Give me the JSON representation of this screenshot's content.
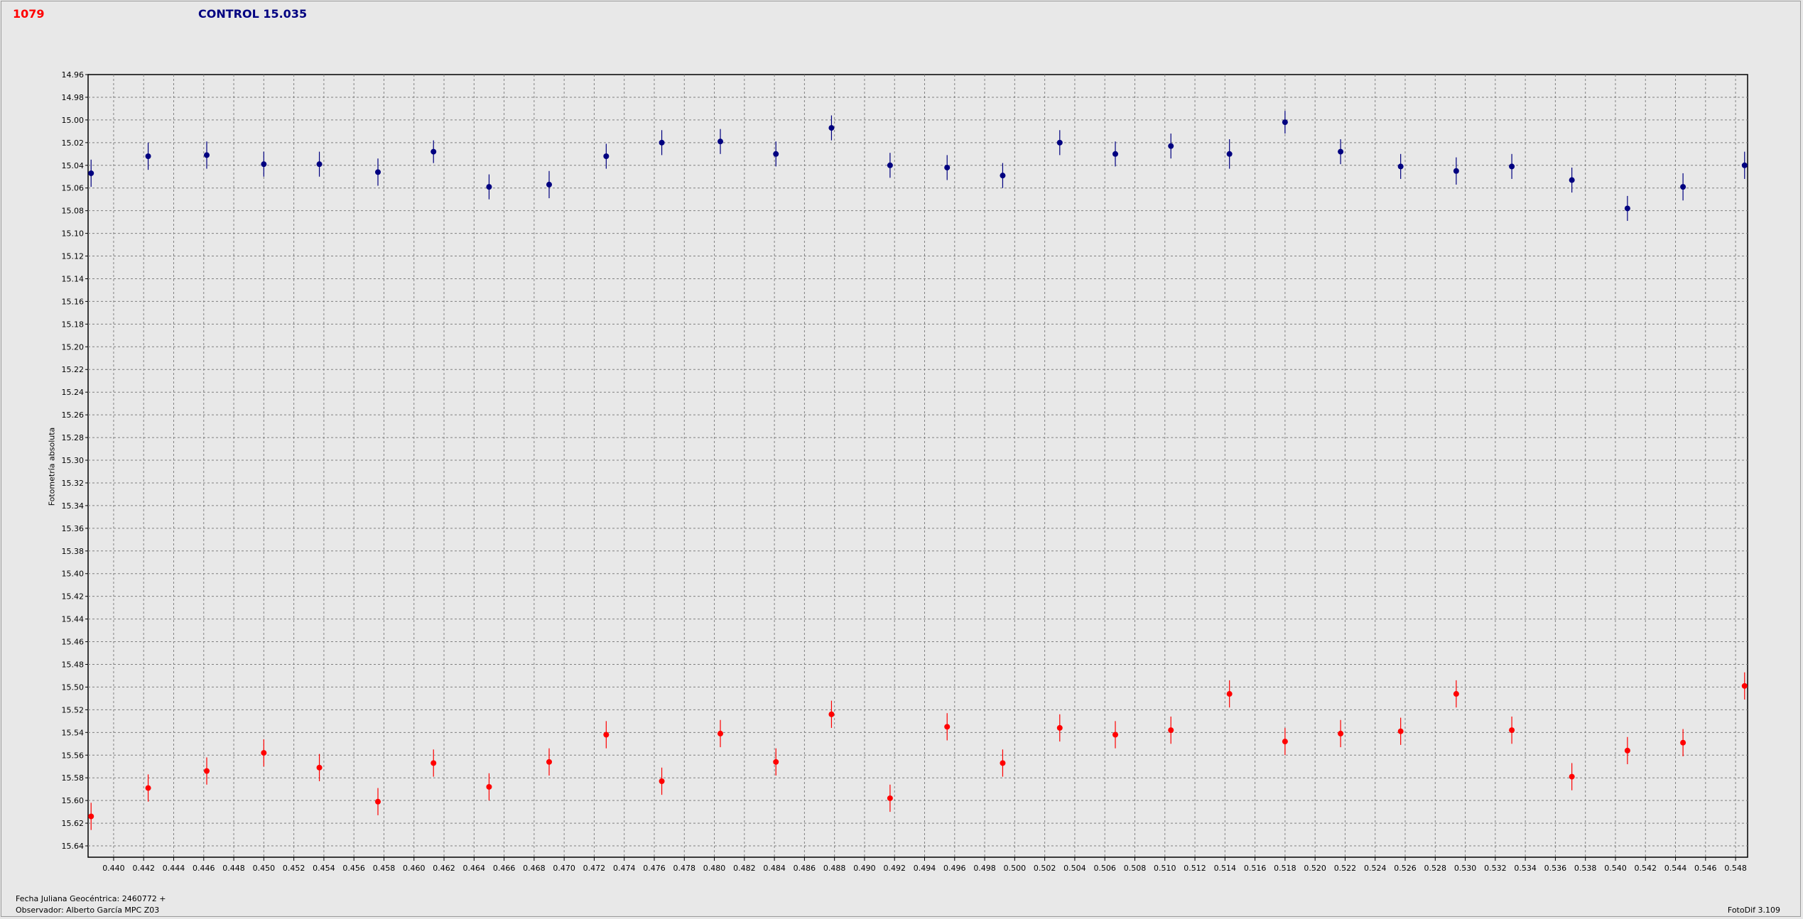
{
  "header": {
    "object_label": "1079",
    "control_label": "CONTROL 15.035"
  },
  "footer": {
    "date_label": "Fecha Juliana Geocéntrica: 2460772 +",
    "observer_label": "Observador: Alberto García MPC Z03",
    "software_label": "FotoDif 3.109"
  },
  "colors": {
    "object_series": "#ff0000",
    "control_series": "#000080",
    "grid": "#808080",
    "background": "#e8e8e8"
  },
  "chart_data": {
    "type": "scatter",
    "ylabel": "Fotometría absoluta",
    "xlabel": "",
    "xlim": [
      0.4383,
      0.5488
    ],
    "ylim": [
      15.65,
      14.96
    ],
    "y_inverted": true,
    "grid": true,
    "error_bars": true,
    "x_ticks": [
      "0.440",
      "0.442",
      "0.444",
      "0.446",
      "0.448",
      "0.450",
      "0.452",
      "0.454",
      "0.456",
      "0.458",
      "0.460",
      "0.462",
      "0.464",
      "0.466",
      "0.468",
      "0.470",
      "0.472",
      "0.474",
      "0.476",
      "0.478",
      "0.480",
      "0.482",
      "0.484",
      "0.486",
      "0.488",
      "0.490",
      "0.492",
      "0.494",
      "0.496",
      "0.498",
      "0.500",
      "0.502",
      "0.504",
      "0.506",
      "0.508",
      "0.510",
      "0.512",
      "0.514",
      "0.516",
      "0.518",
      "0.520",
      "0.522",
      "0.524",
      "0.526",
      "0.528",
      "0.530",
      "0.532",
      "0.534",
      "0.536",
      "0.538",
      "0.540",
      "0.542",
      "0.544",
      "0.546",
      "0.548"
    ],
    "y_ticks": [
      "14.96",
      "14.98",
      "15.00",
      "15.02",
      "15.04",
      "15.06",
      "15.08",
      "15.10",
      "15.12",
      "15.14",
      "15.16",
      "15.18",
      "15.20",
      "15.22",
      "15.24",
      "15.26",
      "15.28",
      "15.30",
      "15.32",
      "15.34",
      "15.36",
      "15.38",
      "15.40",
      "15.42",
      "15.44",
      "15.46",
      "15.48",
      "15.50",
      "15.52",
      "15.54",
      "15.56",
      "15.58",
      "15.60",
      "15.62",
      "15.64"
    ],
    "series": [
      {
        "color": "#000080",
        "x": [
          0.4385,
          0.4423,
          0.4462,
          0.45,
          0.4537,
          0.4576,
          0.4613,
          0.465,
          0.469,
          0.4728,
          0.4765,
          0.4804,
          0.4841,
          0.4878,
          0.4917,
          0.4955,
          0.4992,
          0.503,
          0.5067,
          0.5104,
          0.5143,
          0.518,
          0.5217,
          0.5257,
          0.5294,
          0.5331,
          0.5371,
          0.5408,
          0.5445,
          0.5486
        ],
        "y": [
          15.047,
          15.032,
          15.031,
          15.039,
          15.039,
          15.046,
          15.028,
          15.059,
          15.057,
          15.032,
          15.02,
          15.019,
          15.03,
          15.007,
          15.04,
          15.042,
          15.049,
          15.02,
          15.03,
          15.023,
          15.03,
          15.002,
          15.028,
          15.041,
          15.045,
          15.041,
          15.053,
          15.078,
          15.059,
          15.04
        ],
        "err": [
          0.012,
          0.012,
          0.012,
          0.011,
          0.011,
          0.012,
          0.01,
          0.011,
          0.012,
          0.011,
          0.011,
          0.011,
          0.011,
          0.011,
          0.011,
          0.011,
          0.011,
          0.011,
          0.011,
          0.011,
          0.013,
          0.01,
          0.011,
          0.011,
          0.012,
          0.011,
          0.011,
          0.011,
          0.012,
          0.012
        ]
      },
      {
        "color": "#ff0000",
        "x": [
          0.4385,
          0.4423,
          0.4462,
          0.45,
          0.4537,
          0.4576,
          0.4613,
          0.465,
          0.469,
          0.4728,
          0.4765,
          0.4804,
          0.4841,
          0.4878,
          0.4917,
          0.4955,
          0.4992,
          0.503,
          0.5067,
          0.5104,
          0.5143,
          0.518,
          0.5217,
          0.5257,
          0.5294,
          0.5331,
          0.5371,
          0.5408,
          0.5445,
          0.5486
        ],
        "y": [
          15.614,
          15.589,
          15.574,
          15.558,
          15.571,
          15.601,
          15.567,
          15.588,
          15.566,
          15.542,
          15.583,
          15.541,
          15.566,
          15.524,
          15.598,
          15.535,
          15.567,
          15.536,
          15.542,
          15.538,
          15.506,
          15.548,
          15.541,
          15.539,
          15.506,
          15.538,
          15.579,
          15.556,
          15.549,
          15.499
        ]
      }
    ]
  }
}
